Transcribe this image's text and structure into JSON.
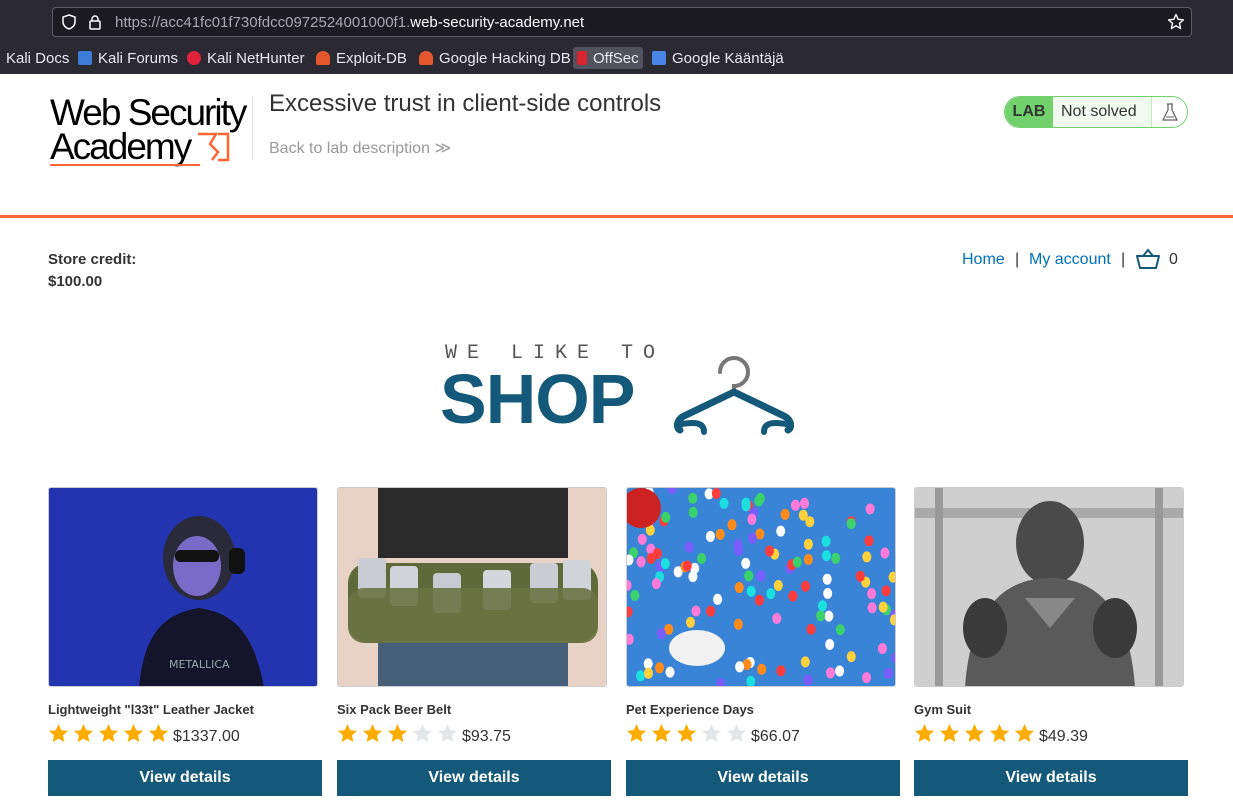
{
  "browser": {
    "url_dim_prefix": "https://acc41fc01f730fdcc0972524001000f1.",
    "url_domain": "web-security-academy.net",
    "bookmarks": [
      {
        "label": "Kali Docs"
      },
      {
        "label": "Kali Forums"
      },
      {
        "label": "Kali NetHunter"
      },
      {
        "label": "Exploit-DB"
      },
      {
        "label": "Google Hacking DB"
      },
      {
        "label": "OffSec"
      },
      {
        "label": "Google Kääntäjä"
      }
    ]
  },
  "header": {
    "logo_line1": "Web Security",
    "logo_line2": "Academy",
    "lab_title": "Excessive trust in client-side controls",
    "back_link": "Back to lab description",
    "back_chevron": "≫",
    "lab_badge": "LAB",
    "lab_status": "Not solved"
  },
  "store": {
    "credit_label": "Store credit:",
    "credit_value": "$100.00"
  },
  "nav": {
    "home": "Home",
    "separator": "|",
    "my_account": "My account",
    "cart_count": "0"
  },
  "banner": {
    "tagline": "WE LIKE TO",
    "word": "SHOP"
  },
  "colors": {
    "accent_orange": "#ff6633",
    "button_blue": "#15597a",
    "link_blue": "#0071bc",
    "lab_green": "#70d16d",
    "star_gold": "#fbac00"
  },
  "products": [
    {
      "name": "Lightweight \"l33t\" Leather Jacket",
      "price": "$1337.00",
      "rating": 5,
      "button": "View details"
    },
    {
      "name": "Six Pack Beer Belt",
      "price": "$93.75",
      "rating": 3,
      "button": "View details"
    },
    {
      "name": "Pet Experience Days",
      "price": "$66.07",
      "rating": 3,
      "button": "View details"
    },
    {
      "name": "Gym Suit",
      "price": "$49.39",
      "rating": 5,
      "button": "View details"
    }
  ]
}
